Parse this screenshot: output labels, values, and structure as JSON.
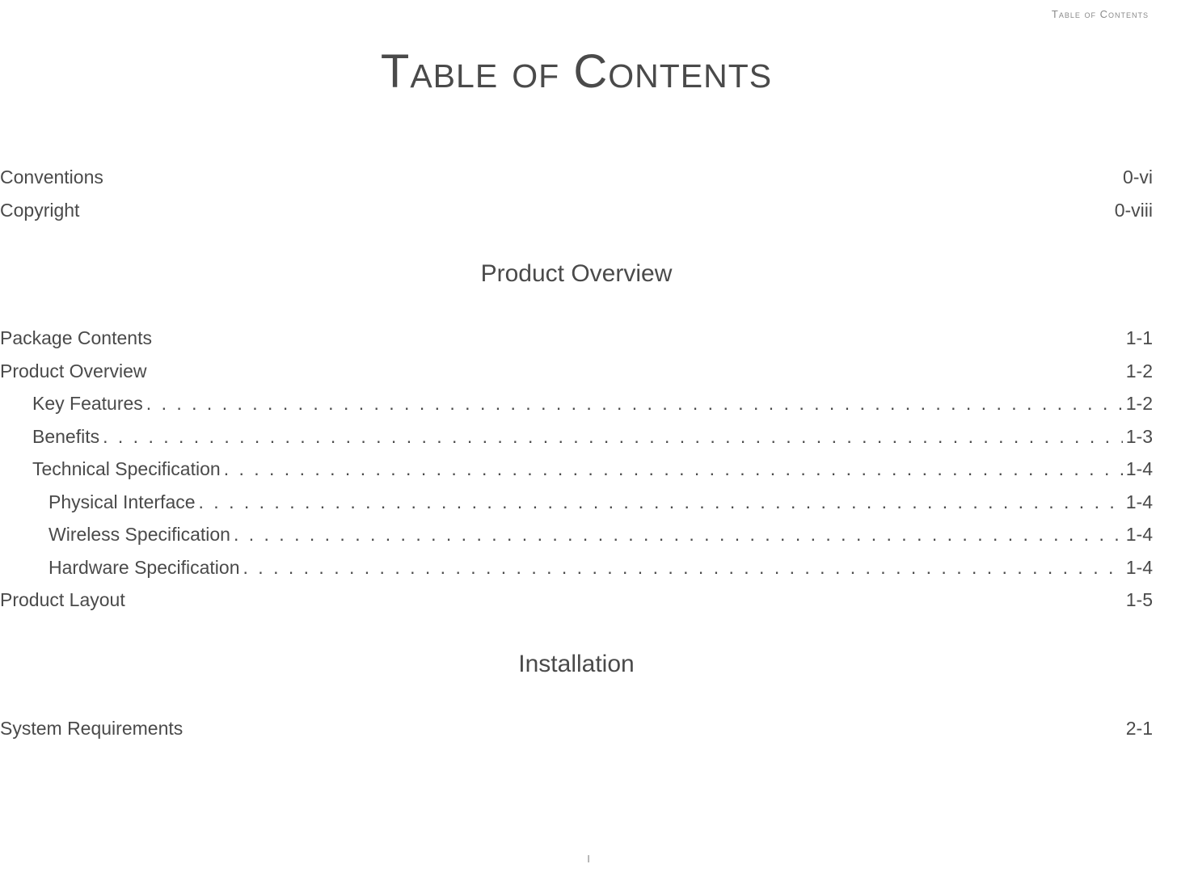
{
  "header": "Table of Contents",
  "title": "Table of Contents",
  "entries": [
    {
      "title": "Conventions",
      "page": "0-vi",
      "level": 0,
      "dots": false
    },
    {
      "title": "Copyright",
      "page": "0-viii",
      "level": 0,
      "dots": false
    }
  ],
  "sections": [
    {
      "heading": "Product Overview",
      "entries": [
        {
          "title": "Package Contents",
          "page": "1-1",
          "level": 0,
          "dots": false
        },
        {
          "title": "Product Overview",
          "page": "1-2",
          "level": 0,
          "dots": false
        },
        {
          "title": "Key Features ",
          "page": "1-2",
          "level": 1,
          "dots": true
        },
        {
          "title": "Benefits",
          "page": "1-3",
          "level": 1,
          "dots": true
        },
        {
          "title": "Technical Specification",
          "page": "1-4",
          "level": 1,
          "dots": true
        },
        {
          "title": "Physical Interface",
          "page": "1-4",
          "level": 2,
          "dots": true
        },
        {
          "title": "Wireless Specification",
          "page": "1-4",
          "level": 2,
          "dots": true
        },
        {
          "title": "Hardware Specification",
          "page": "1-4",
          "level": 2,
          "dots": true
        },
        {
          "title": "Product Layout",
          "page": "1-5",
          "level": 0,
          "dots": false
        }
      ]
    },
    {
      "heading": "Installation",
      "entries": [
        {
          "title": "System Requirements",
          "page": "2-1",
          "level": 0,
          "dots": false
        }
      ]
    }
  ],
  "page_number": "I"
}
